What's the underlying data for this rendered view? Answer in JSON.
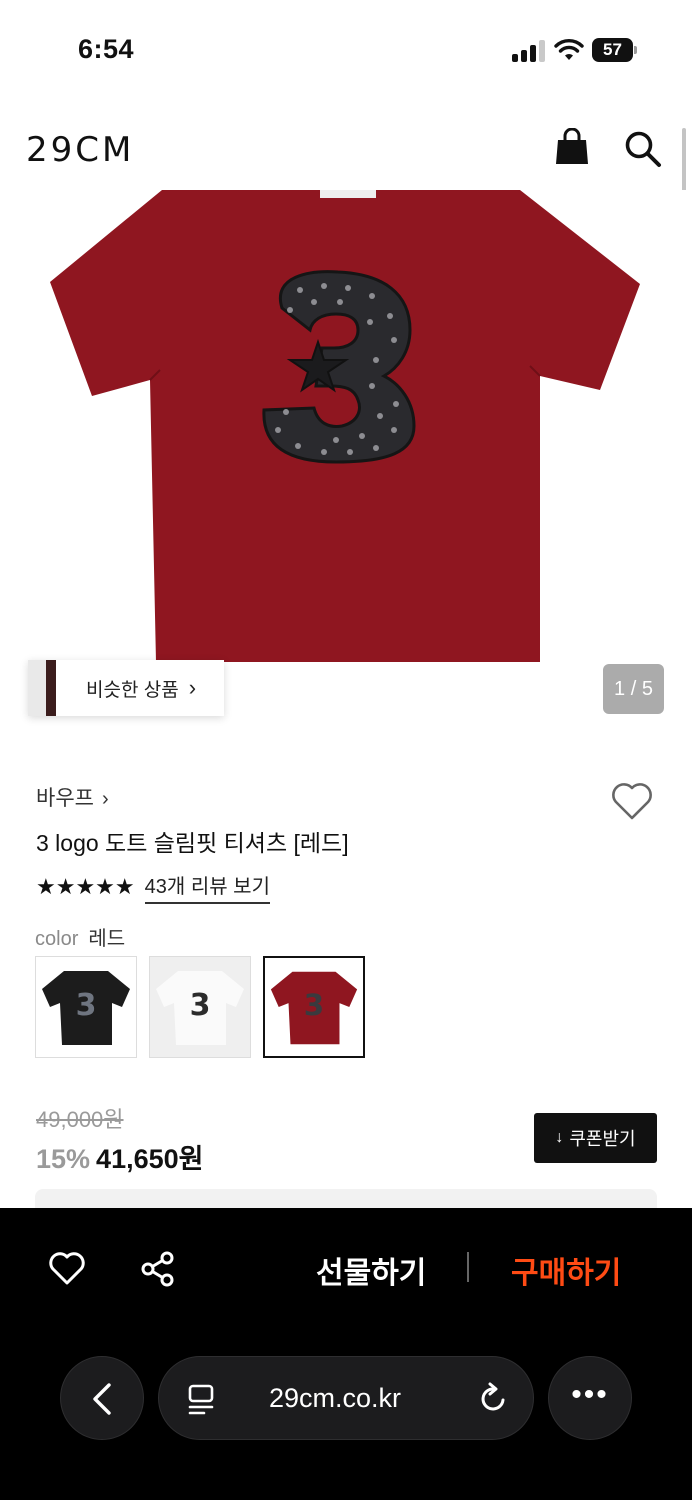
{
  "status_bar": {
    "time": "6:54",
    "battery": "57"
  },
  "header": {
    "logo": "29CM",
    "cart_icon": "shopping-bag-icon",
    "search_icon": "search-icon"
  },
  "gallery": {
    "similar_label": "비슷한 상품",
    "similar_chevron": "›",
    "counter": "1 / 5",
    "shirt_color": "#8f1620",
    "logo_digit": "3"
  },
  "product": {
    "brand": "바우프",
    "brand_chevron": "›",
    "title": "3 logo 도트 슬림핏 티셔츠 [레드]",
    "stars": "★★★★★",
    "rating": 5,
    "review_link": "43개 리뷰 보기",
    "color_label": "color",
    "color_value": "레드",
    "swatches": [
      {
        "color": "black",
        "digit": "3",
        "selected": false
      },
      {
        "color": "white",
        "digit": "3",
        "selected": false
      },
      {
        "color": "red",
        "digit": "3",
        "selected": true
      }
    ],
    "original_price": "49,000원",
    "discount": "15%",
    "price": "41,650원",
    "coupon_icon": "↓",
    "coupon_label": "쿠폰받기"
  },
  "action_bar": {
    "gift_label": "선물하기",
    "buy_label": "구매하기",
    "buy_color": "#ff4b14"
  },
  "browser": {
    "url": "29cm.co.kr",
    "more": "•••"
  }
}
